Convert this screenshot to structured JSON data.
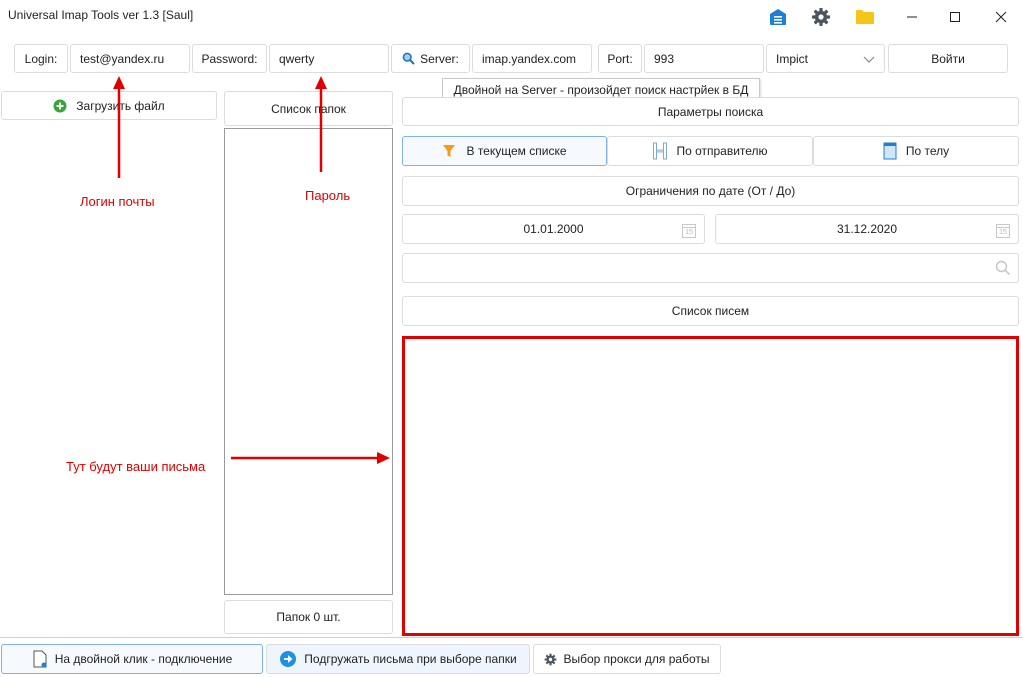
{
  "window": {
    "title": "Universal Imap Tools ver 1.3 [Saul]"
  },
  "colors": {
    "annotation": "#e00000",
    "accent": "#1e7fd6",
    "folder": "#f5c518",
    "green": "#3aa53a"
  },
  "connection": {
    "login_label": "Login:",
    "login_value": "test@yandex.ru",
    "password_label": "Password:",
    "password_value": "qwerty",
    "server_label": "Server:",
    "server_value": "imap.yandex.com",
    "port_label": "Port:",
    "port_value": "993",
    "security_value": "Impict",
    "connect_button": "Войти"
  },
  "tooltip": "Двойной на Server - произойдет поиск настрйек в БД",
  "left_panel": {
    "upload_button": "Загрузить файл"
  },
  "folders_panel": {
    "header": "Список папок",
    "count_label": "Папок 0 шт."
  },
  "search": {
    "params_header": "Параметры поиска",
    "tabs": [
      "В текущем списке",
      "По отправителю",
      "По телу"
    ],
    "date_header": "Ограничения по дате (От / До)",
    "date_from": "01.01.2000",
    "date_to": "31.12.2020",
    "calendar_day": "15",
    "query_value": "",
    "messages_header": "Список писем"
  },
  "annotations": {
    "login": "Логин почты",
    "password": "Пароль",
    "messages": "Тут будут ваши письма"
  },
  "bottom_bar": {
    "connect_hint": "На двойной клик - подключение",
    "load_on_select": "Подгружать письма при выборе папки",
    "proxy": "Выбор прокси для работы"
  }
}
